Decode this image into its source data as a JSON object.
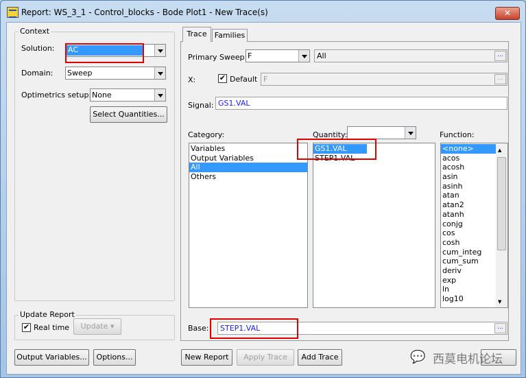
{
  "window": {
    "title": "Report: WS_3_1 - Control_blocks - Bode Plot1 - New Trace(s)",
    "close": "✕"
  },
  "context": {
    "label": "Context",
    "solution_label": "Solution:",
    "solution": "AC",
    "domain_label": "Domain:",
    "domain": "Sweep",
    "optimetrics_label": "Optimetrics setup:",
    "optimetrics": "None",
    "select_quantities": "Select Quantities..."
  },
  "update": {
    "label": "Update Report",
    "realtime_label": "Real time",
    "realtime_checked": true,
    "update_button": "Update"
  },
  "left_buttons": {
    "output_variables": "Output Variables...",
    "options": "Options..."
  },
  "tabs": [
    {
      "label": "Trace",
      "active": true
    },
    {
      "label": "Families",
      "active": false
    }
  ],
  "trace": {
    "primary_sweep_label": "Primary Sweep:",
    "primary_sweep": "F",
    "sweep_range": "All",
    "x_label": "X:",
    "default_label": "Default",
    "default_checked": true,
    "x_value": "F",
    "signal_label": "Signal:",
    "signal": "GS1.VAL",
    "category_label": "Category:",
    "quantity_label": "Quantity:",
    "quantity_filter": "",
    "function_label": "Function:",
    "categories": [
      "Variables",
      "Output Variables",
      "All",
      "Others"
    ],
    "selected_category": "All",
    "quantities": [
      "GS1.VAL",
      "STEP1.VAL"
    ],
    "selected_quantity": "GS1.VAL",
    "functions": [
      "<none>",
      "acos",
      "acosh",
      "asin",
      "asinh",
      "atan",
      "atan2",
      "atanh",
      "conjg",
      "cos",
      "cosh",
      "cum_integ",
      "cum_sum",
      "deriv",
      "exp",
      "ln",
      "log10"
    ],
    "selected_function": "<none>",
    "base_label": "Base:",
    "base": "STEP1.VAL",
    "ellipsis": "..."
  },
  "bottom_buttons": {
    "new_report": "New Report",
    "apply_trace": "Apply Trace",
    "add_trace": "Add Trace"
  },
  "watermark": "西莫电机论坛",
  "colors": {
    "selection": "#3399ff",
    "highlight_box": "#e00000",
    "value_text": "#1a1aff"
  }
}
